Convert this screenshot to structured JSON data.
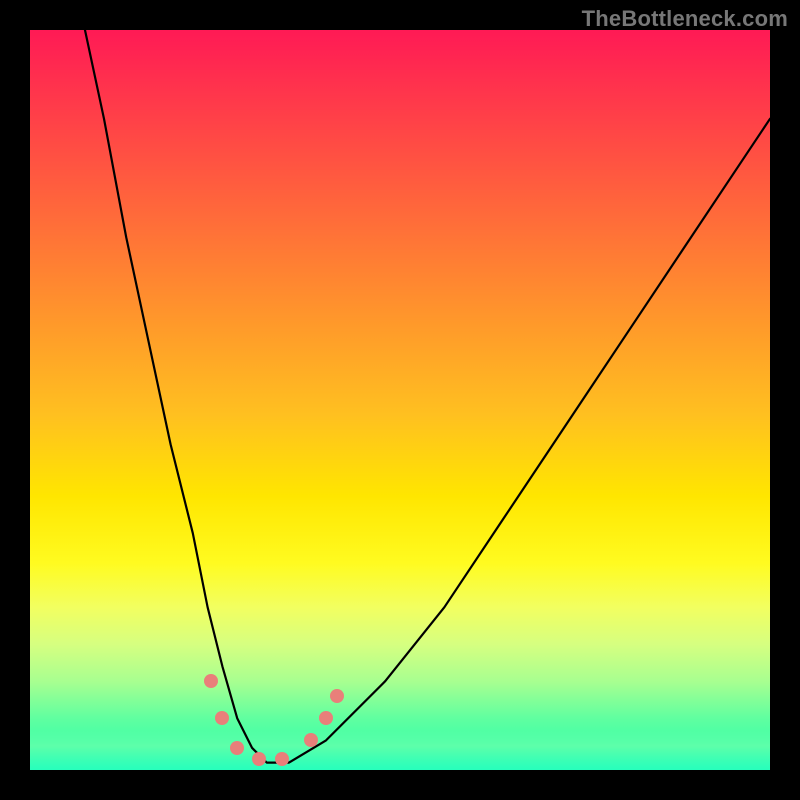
{
  "watermark": "TheBottleneck.com",
  "chart_data": {
    "type": "line",
    "title": "",
    "xlabel": "",
    "ylabel": "",
    "xlim": [
      0,
      100
    ],
    "ylim": [
      0,
      100
    ],
    "grid": false,
    "legend": false,
    "background_gradient": {
      "top": "#ff1a55",
      "mid": "#ffe600",
      "bottom": "#1fffb0"
    },
    "series": [
      {
        "name": "bottleneck-curve",
        "x": [
          7,
          10,
          13,
          16,
          19,
          22,
          24,
          26,
          28,
          30,
          32,
          35,
          40,
          48,
          56,
          64,
          72,
          80,
          88,
          96,
          100
        ],
        "values": [
          102,
          88,
          72,
          58,
          44,
          32,
          22,
          14,
          7,
          3,
          1,
          1,
          4,
          12,
          22,
          34,
          46,
          58,
          70,
          82,
          88
        ]
      }
    ],
    "markers": [
      {
        "x": 24.5,
        "y": 12
      },
      {
        "x": 26.0,
        "y": 7
      },
      {
        "x": 28.0,
        "y": 3
      },
      {
        "x": 31.0,
        "y": 1.5
      },
      {
        "x": 34.0,
        "y": 1.5
      },
      {
        "x": 38.0,
        "y": 4
      },
      {
        "x": 40.0,
        "y": 7
      },
      {
        "x": 41.5,
        "y": 10
      }
    ],
    "annotations": []
  }
}
